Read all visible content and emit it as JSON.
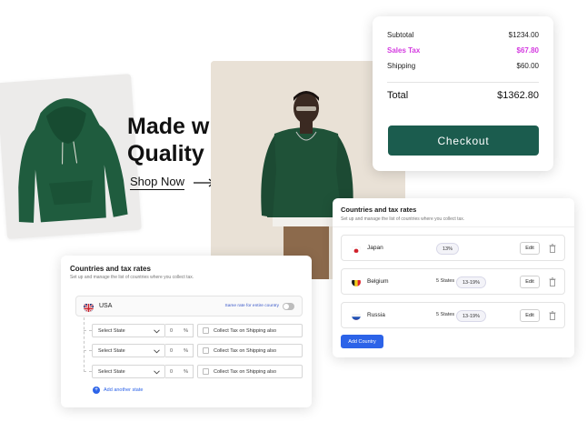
{
  "hero": {
    "title_line1": "Made with",
    "title_line2": "Quality",
    "shop_now": "Shop Now"
  },
  "summary": {
    "subtotal_label": "Subtotal",
    "subtotal_value": "$1234.00",
    "tax_label": "Sales Tax",
    "tax_value": "$67.80",
    "shipping_label": "Shipping",
    "shipping_value": "$60.00",
    "total_label": "Total",
    "total_value": "$1362.80",
    "checkout_label": "Checkout"
  },
  "countries_right": {
    "title": "Countries and tax rates",
    "subtitle": "Set up and manage the list of countries where you collect tax.",
    "rows": [
      {
        "name": "Japan",
        "states": "",
        "rate": "13%",
        "edit": "Edit"
      },
      {
        "name": "Belgium",
        "states": "5 States",
        "rate": "13-19%",
        "edit": "Edit"
      },
      {
        "name": "Russia",
        "states": "5 States",
        "rate": "13-19%",
        "edit": "Edit"
      }
    ],
    "add_country": "Add Country"
  },
  "countries_left": {
    "title": "Countries and tax rates",
    "subtitle": "Set up and manage the list of countries where you collect tax.",
    "country": "USA",
    "same_rate": "Same rate for entire country",
    "state_rows": [
      {
        "select": "Select State",
        "rate": "0",
        "unit": "%",
        "shipping": "Collect Tax on Shipping also"
      },
      {
        "select": "Select State",
        "rate": "0",
        "unit": "%",
        "shipping": "Collect Tax on Shipping also"
      },
      {
        "select": "Select State",
        "rate": "0",
        "unit": "%",
        "shipping": "Collect Tax on Shipping also"
      }
    ],
    "add_state": "Add another state"
  },
  "colors": {
    "accent_green": "#1b5c4e",
    "tax_magenta": "#d43be0",
    "link_blue": "#2c63e8"
  },
  "icons": [
    "arrow-right-icon",
    "trash-icon",
    "chevron-down-icon",
    "plus-icon",
    "flag-icon"
  ]
}
